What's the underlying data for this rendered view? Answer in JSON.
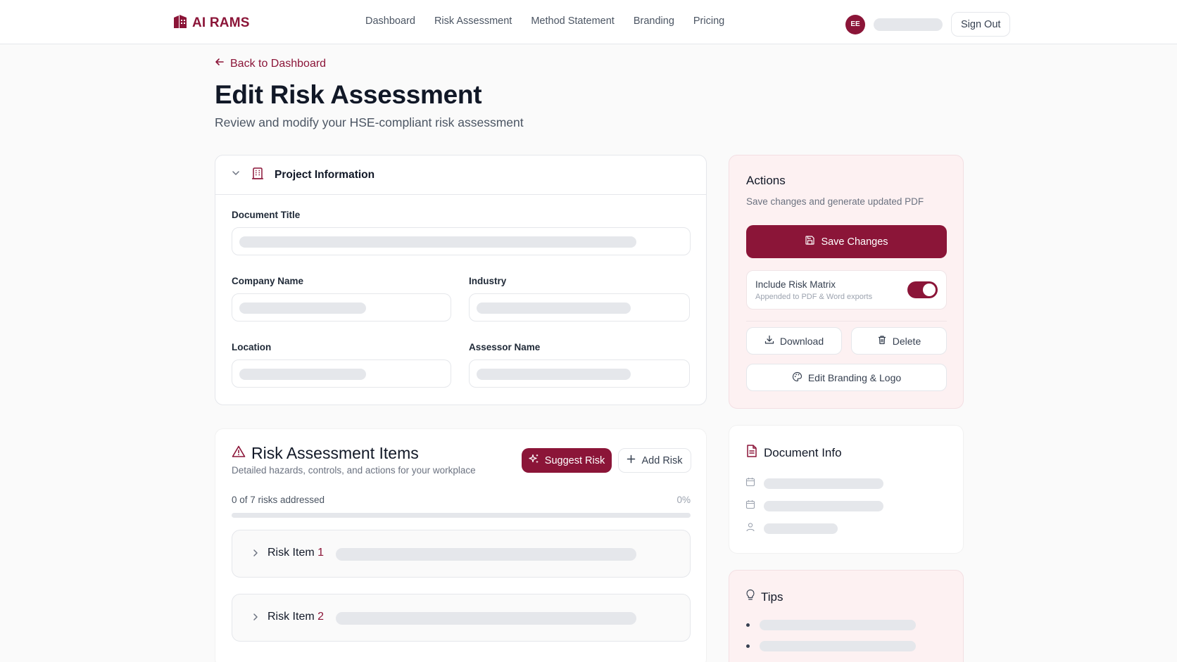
{
  "brand": {
    "name": "AI RAMS",
    "color": "#8b1538",
    "icon": "building-logo-icon"
  },
  "nav": {
    "items": [
      {
        "label": "Dashboard"
      },
      {
        "label": "Risk Assessment"
      },
      {
        "label": "Method Statement"
      },
      {
        "label": "Branding"
      },
      {
        "label": "Pricing"
      }
    ]
  },
  "user": {
    "initials": "EE",
    "sign_out_label": "Sign Out"
  },
  "page": {
    "back_label": "Back to Dashboard",
    "title": "Edit Risk Assessment",
    "subtitle": "Review and modify your HSE-compliant risk assessment"
  },
  "project": {
    "section_title": "Project Information",
    "fields": {
      "document_title": "Document Title",
      "company_name": "Company Name",
      "industry": "Industry",
      "location": "Location",
      "assessor_name": "Assessor Name"
    }
  },
  "risks": {
    "title": "Risk Assessment Items",
    "subtitle": "Detailed hazards, controls, and actions for your workplace",
    "suggest_label": "Suggest Risk",
    "add_label": "Add Risk",
    "progress_text": "0 of 7 risks addressed",
    "progress_percent_label": "0%",
    "progress_fraction": 0,
    "items": [
      {
        "label": "Risk Item",
        "number": "1"
      },
      {
        "label": "Risk Item",
        "number": "2"
      }
    ]
  },
  "actions": {
    "title": "Actions",
    "subtitle": "Save changes and generate updated PDF",
    "save_label": "Save Changes",
    "matrix_title": "Include Risk Matrix",
    "matrix_sub": "Appended to PDF & Word exports",
    "matrix_enabled": true,
    "download_label": "Download",
    "delete_label": "Delete",
    "branding_label": "Edit Branding & Logo"
  },
  "doc_info": {
    "title": "Document Info"
  },
  "tips": {
    "title": "Tips"
  }
}
